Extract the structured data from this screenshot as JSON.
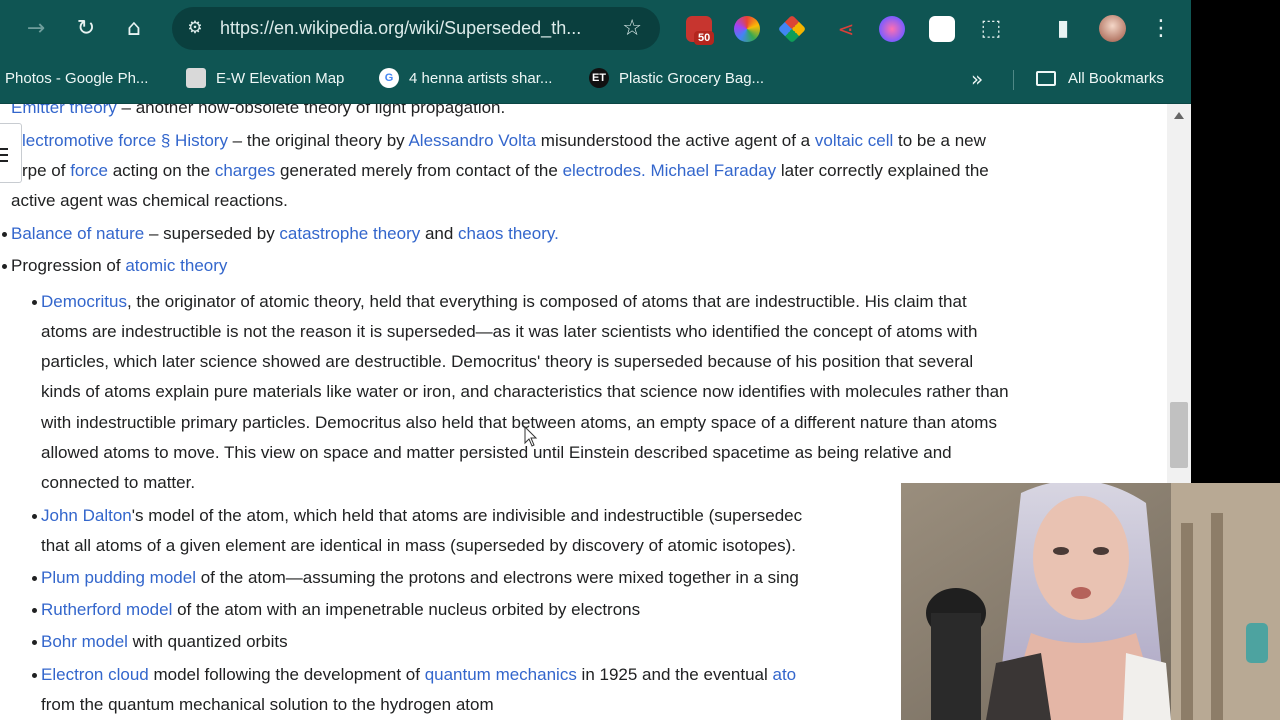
{
  "browser": {
    "url": "https://en.wikipedia.org/wiki/Superseded_th...",
    "extension_badge": "50",
    "icons": [
      "forward-icon",
      "reload-icon",
      "home-icon",
      "site-info-icon",
      "bookmark-star-icon",
      "extensions-icon",
      "side-panel-icon",
      "menu-icon"
    ]
  },
  "bookmarks": {
    "items": [
      {
        "label": "Photos - Google Ph..."
      },
      {
        "label": "E-W Elevation Map"
      },
      {
        "label": "4 henna artists shar..."
      },
      {
        "label": "Plastic Grocery Bag...",
        "icon_text": "ET"
      }
    ],
    "all_label": "All Bookmarks"
  },
  "article": {
    "emitter": {
      "link": "Emitter theory",
      "text": " – another now-obsolete theory of light propagation."
    },
    "emf": {
      "link1": "lectromotive force § History",
      "t1": " – the original theory by ",
      "link2": "Alessandro Volta",
      "t2": " misunderstood the active agent of a ",
      "link3": "voltaic cell",
      "t3": " to be a new",
      "t4": "rpe of ",
      "link4": "force",
      "t5": " acting on the ",
      "link5": "charges",
      "t6": " generated merely from contact of the ",
      "link6": "electrodes.",
      "t7": " ",
      "link7": "Michael Faraday",
      "t8": " later correctly explained the",
      "t9": "active agent was chemical reactions."
    },
    "balance": {
      "link1": "Balance of nature",
      "t1": " – superseded by ",
      "link2": "catastrophe theory",
      "t2": " and ",
      "link3": "chaos theory."
    },
    "progression": {
      "t1": "Progression of ",
      "link1": "atomic theory"
    },
    "democritus": {
      "link": "Democritus",
      "l1": ", the originator of atomic theory, held that everything is composed of atoms that are indestructible. His claim that",
      "l2": "atoms are indestructible is not the reason it is superseded—as it was later scientists who identified the concept of atoms with",
      "l3": "particles, which later science showed are destructible. Democritus' theory is superseded because of his position that several",
      "l4": "kinds of atoms explain pure materials like water or iron, and characteristics that science now identifies with molecules rather than",
      "l5": "with indestructible primary particles. Democritus also held that between atoms, an empty space of a different nature than atoms",
      "l6": "allowed atoms to move. This view on space and matter persisted until Einstein described spacetime as being relative and",
      "l7": "connected to matter."
    },
    "dalton": {
      "link": "John Dalton",
      "l1": "'s model of the atom, which held that atoms are indivisible and indestructible (supersedec",
      "l2": "that all atoms of a given element are identical in mass (superseded by discovery of atomic isotopes)."
    },
    "plum": {
      "link": "Plum pudding model",
      "t": " of the atom—assuming the protons and electrons were mixed together in a sing"
    },
    "rutherford": {
      "link": "Rutherford model",
      "t": " of the atom with an impenetrable nucleus orbited by electrons"
    },
    "bohr": {
      "link": "Bohr model",
      "t": " with quantized orbits"
    },
    "cloud": {
      "link": "Electron cloud",
      "t1": " model following the development of ",
      "link2": "quantum mechanics",
      "t2": " in 1925 and the eventual ",
      "link3": "ato",
      "l2": "from the quantum mechanical solution to the hydrogen atom"
    }
  },
  "colors": {
    "toolbar": "#0f5553",
    "link": "#3366cc",
    "text": "#202122"
  }
}
